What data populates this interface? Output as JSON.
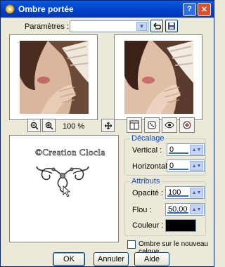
{
  "window": {
    "title": "Ombre portée"
  },
  "params": {
    "label": "Paramètres :",
    "value": ""
  },
  "zoom": {
    "value": "100 %"
  },
  "decalage": {
    "title": "Décalage",
    "vertical_label": "Vertical :",
    "vertical_value": "0",
    "horizontal_label": "Horizontal :",
    "horizontal_value": "0"
  },
  "attributs": {
    "title": "Attributs",
    "opacite_label": "Opacité :",
    "opacite_value": "100",
    "flou_label": "Flou :",
    "flou_value": "50,00",
    "couleur_label": "Couleur :",
    "couleur_value": "#000000"
  },
  "checkbox": {
    "label": "Ombre sur le nouveau calque"
  },
  "buttons": {
    "ok": "OK",
    "cancel": "Annuler",
    "help": "Aide"
  },
  "canvas": {
    "watermark": "©Creation Clocla"
  }
}
